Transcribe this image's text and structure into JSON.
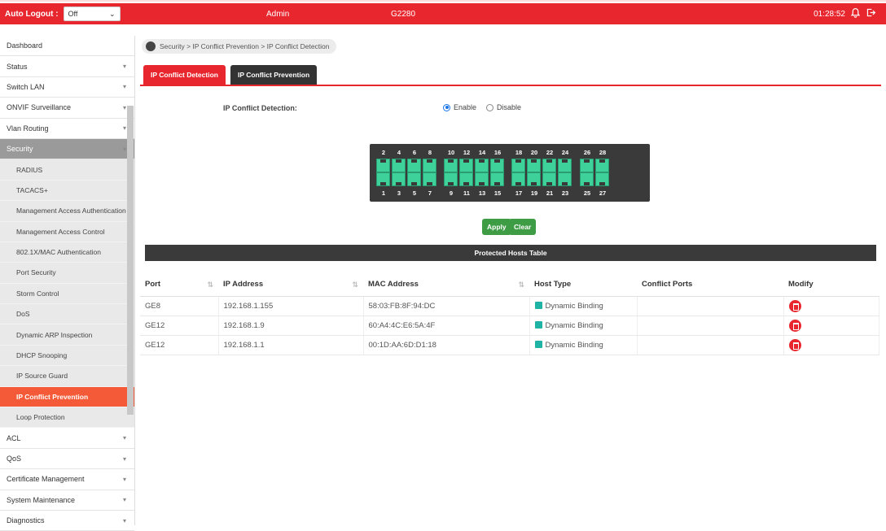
{
  "topbar": {
    "logout_label": "Auto Logout :",
    "logout_value": "Off",
    "user": "Admin",
    "model": "G2280",
    "time": "01:28:52"
  },
  "sidebar": {
    "items": [
      {
        "label": "Dashboard",
        "chevron": false
      },
      {
        "label": "Status",
        "chevron": true
      },
      {
        "label": "Switch LAN",
        "chevron": true
      },
      {
        "label": "ONVIF Surveillance",
        "chevron": true
      },
      {
        "label": "Vlan Routing",
        "chevron": true
      },
      {
        "label": "Security",
        "chevron": true
      }
    ],
    "security_sub": [
      "RADIUS",
      "TACACS+",
      "Management Access Authentication",
      "Management Access Control",
      "802.1X/MAC Authentication",
      "Port Security",
      "Storm Control",
      "DoS",
      "Dynamic ARP Inspection",
      "DHCP Snooping",
      "IP Source Guard",
      "IP Conflict Prevention",
      "Loop Protection"
    ],
    "selected_sub": "IP Conflict Prevention",
    "items_after": [
      "ACL",
      "QoS",
      "Certificate Management",
      "System Maintenance",
      "Diagnostics"
    ]
  },
  "breadcrumb": "Security > IP Conflict Prevention > IP Conflict Detection",
  "tabs": [
    "IP Conflict Detection",
    "IP Conflict Prevention"
  ],
  "detection": {
    "label": "IP Conflict Detection:",
    "enable": "Enable",
    "disable": "Disable",
    "selected": "Enable"
  },
  "ports": {
    "top": [
      "2",
      "4",
      "6",
      "8",
      "10",
      "12",
      "14",
      "16",
      "18",
      "20",
      "22",
      "24",
      "26",
      "28"
    ],
    "bottom": [
      "1",
      "3",
      "5",
      "7",
      "9",
      "11",
      "13",
      "15",
      "17",
      "19",
      "21",
      "23",
      "25",
      "27"
    ]
  },
  "buttons": {
    "apply": "Apply",
    "clear": "Clear"
  },
  "table": {
    "title": "Protected Hosts Table",
    "columns": [
      "Port",
      "IP Address",
      "MAC Address",
      "Host Type",
      "Conflict Ports",
      "Modify"
    ],
    "rows": [
      {
        "port": "GE8",
        "ip": "192.168.1.155",
        "mac": "58:03:FB:8F:94:DC",
        "host_type": "Dynamic Binding",
        "conflict": ""
      },
      {
        "port": "GE12",
        "ip": "192.168.1.9",
        "mac": "60:A4:4C:E6:5A:4F",
        "host_type": "Dynamic Binding",
        "conflict": ""
      },
      {
        "port": "GE12",
        "ip": "192.168.1.1",
        "mac": "00:1D:AA:6D:D1:18",
        "host_type": "Dynamic Binding",
        "conflict": ""
      }
    ]
  },
  "colors": {
    "brand": "#e8262e",
    "selected": "#f45a37",
    "port": "#3fd19a",
    "apply": "#3d9c44"
  }
}
